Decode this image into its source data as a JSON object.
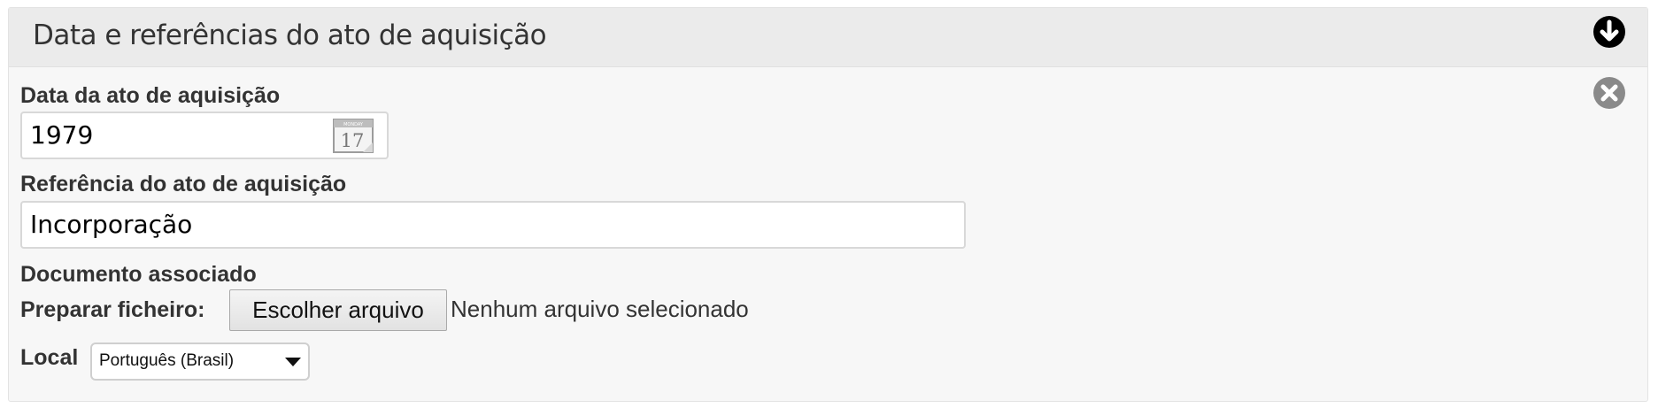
{
  "panel": {
    "title": "Data e referências do ato de aquisição",
    "toggle_icon": "arrow-down-circle-icon",
    "remove_icon": "close-circle-icon"
  },
  "form": {
    "date": {
      "label": "Data da ato de aquisição",
      "value": "1979",
      "calendar_icon": "calendar-icon",
      "calendar_day": "17"
    },
    "reference": {
      "label": "Referência do ato de aquisição",
      "value": "Incorporação"
    },
    "document": {
      "label": "Documento associado",
      "prepare_label": "Preparar ficheiro:",
      "choose_button": "Escolher arquivo",
      "status": "Nenhum arquivo selecionado"
    },
    "locale": {
      "label": "Local",
      "selected": "Português (Brasil)"
    }
  },
  "colors": {
    "panel_background": "#f7f7f7",
    "header_background": "#ebebeb",
    "text": "#333333",
    "toggle_icon": "#000000",
    "remove_icon": "#8a8a8a"
  }
}
